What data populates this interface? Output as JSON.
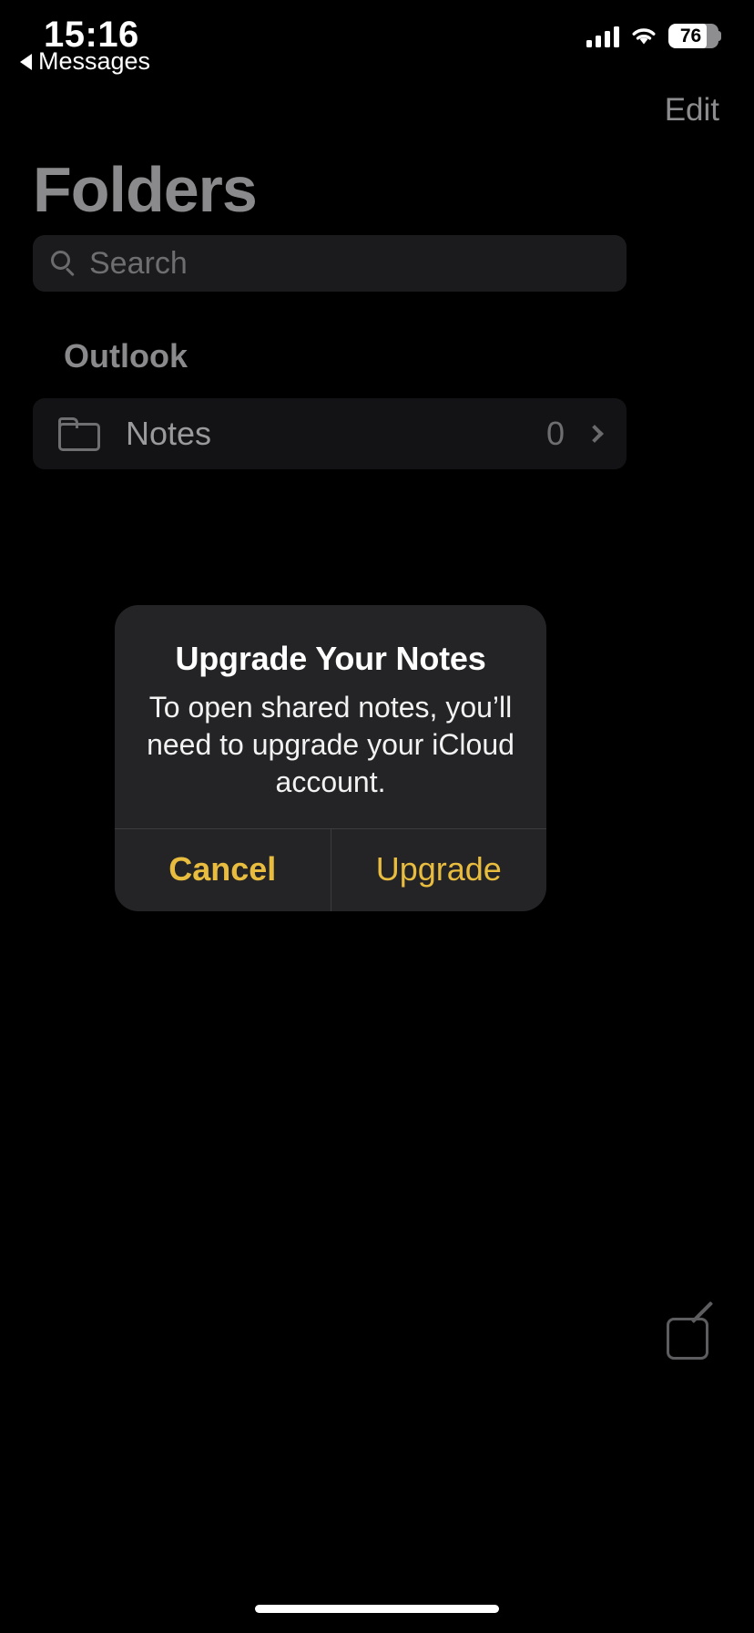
{
  "status_bar": {
    "time": "15:16",
    "battery_level": "76",
    "signal_icon": "cellular-bars-icon",
    "wifi_icon": "wifi-icon",
    "battery_icon": "battery-icon"
  },
  "back_link": {
    "label": "Messages",
    "icon": "back-triangle-icon"
  },
  "nav": {
    "edit_label": "Edit",
    "title": "Folders"
  },
  "search": {
    "placeholder": "Search",
    "icon": "search-icon"
  },
  "sections": [
    {
      "header": "Outlook",
      "rows": [
        {
          "icon": "folder-icon",
          "label": "Notes",
          "count": "0",
          "chevron": "chevron-right-icon"
        }
      ]
    }
  ],
  "alert": {
    "title": "Upgrade Your Notes",
    "message": "To open shared notes, you’ll need to upgrade your iCloud account.",
    "cancel_label": "Cancel",
    "confirm_label": "Upgrade",
    "accent_color": "#e8bc3e",
    "background_color": "#242426"
  },
  "toolbar": {
    "compose_icon": "compose-note-icon"
  },
  "home_indicator": "home-indicator"
}
